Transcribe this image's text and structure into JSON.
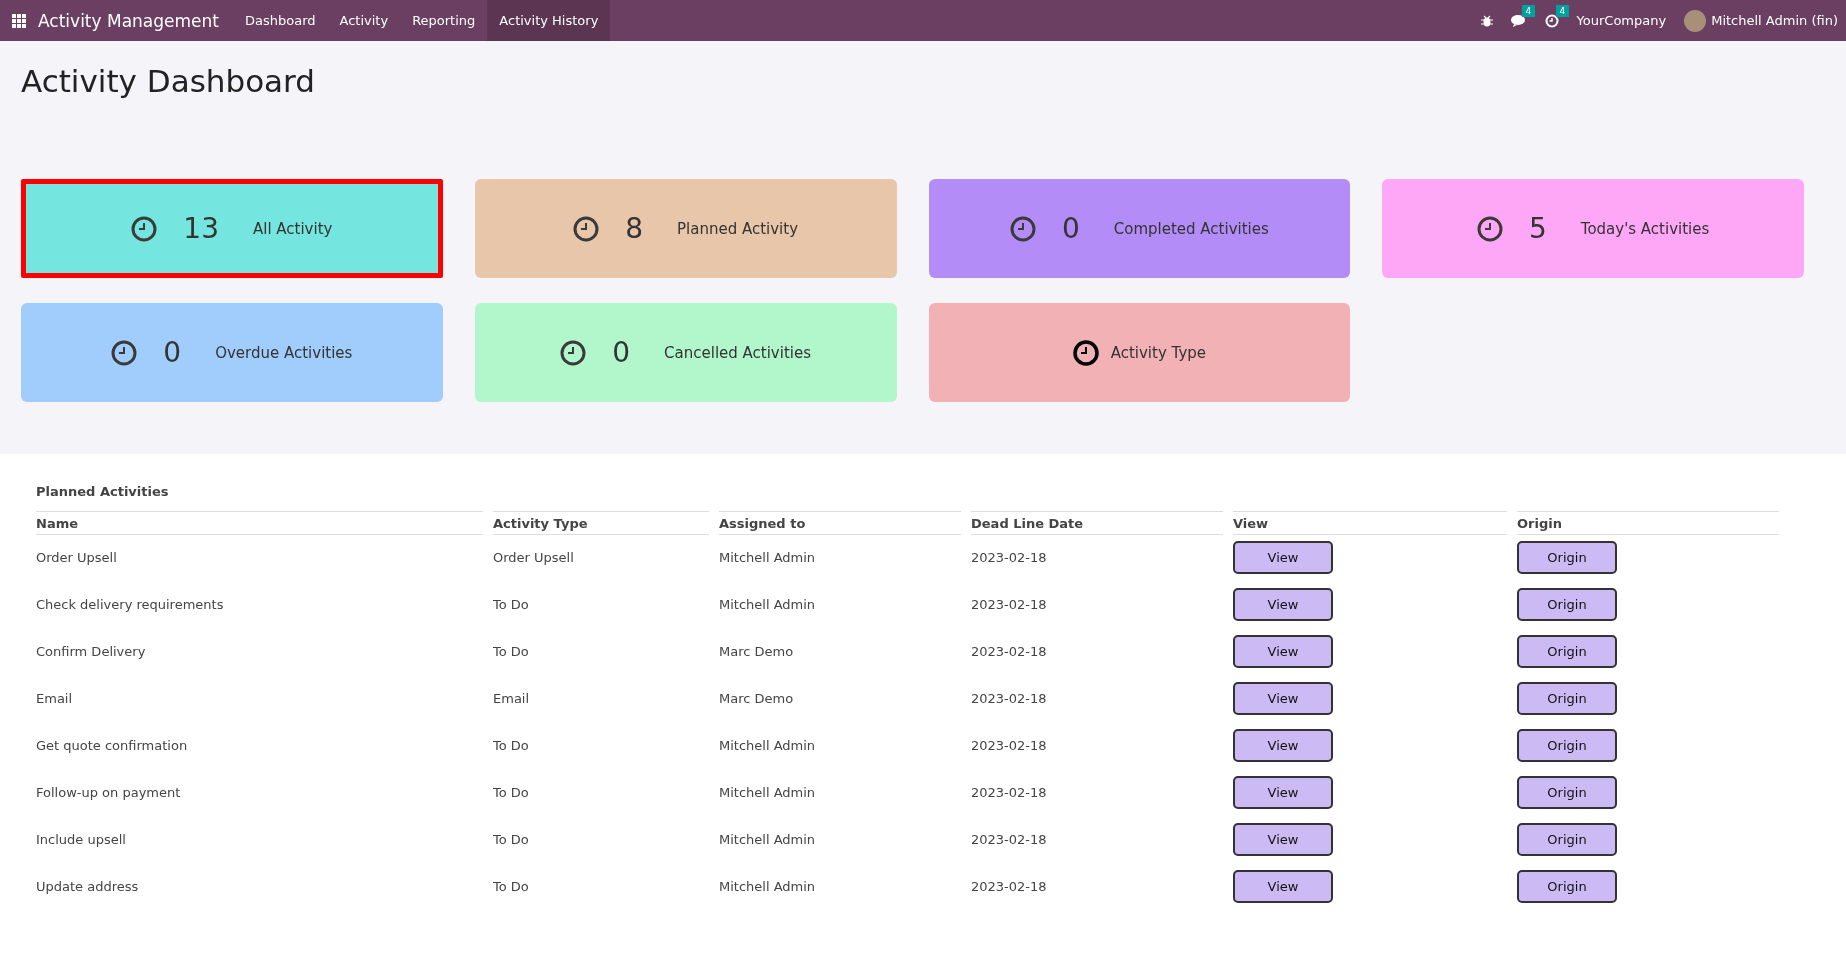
{
  "navbar": {
    "app_title": "Activity Management",
    "menu": [
      {
        "label": "Dashboard",
        "selected": false
      },
      {
        "label": "Activity",
        "selected": false
      },
      {
        "label": "Reporting",
        "selected": false
      },
      {
        "label": "Activity History",
        "selected": true
      }
    ],
    "messages_count": "4",
    "activities_count": "4",
    "company": "YourCompany",
    "user": "Mitchell Admin (fin)"
  },
  "page_title": "Activity Dashboard",
  "cards": [
    {
      "kind": "count",
      "count": "13",
      "label": "All Activity",
      "color": "#75e6df",
      "selected": true
    },
    {
      "kind": "count",
      "count": "8",
      "label": "Planned Activity",
      "color": "#e8c6a9",
      "selected": false
    },
    {
      "kind": "count",
      "count": "0",
      "label": "Completed Activities",
      "color": "#b48cf7",
      "selected": false
    },
    {
      "kind": "count",
      "count": "5",
      "label": "Today's Activities",
      "color": "#fea7f6",
      "selected": false
    },
    {
      "kind": "count",
      "count": "0",
      "label": "Overdue Activities",
      "color": "#a1cdfc",
      "selected": false
    },
    {
      "kind": "count",
      "count": "0",
      "label": "Cancelled Activities",
      "color": "#b2f6cc",
      "selected": false
    },
    {
      "kind": "type",
      "label": "Activity Type",
      "color": "#f2b1b5",
      "selected": false
    }
  ],
  "table": {
    "title": "Planned Activities",
    "columns": [
      "Name",
      "Activity Type",
      "Assigned to",
      "Dead Line Date",
      "View",
      "Origin"
    ],
    "rows": [
      {
        "name": "Order Upsell",
        "type": "Order Upsell",
        "assigned": "Mitchell Admin",
        "deadline": "2023-02-18",
        "view": "View",
        "origin": "Origin"
      },
      {
        "name": "Check delivery requirements",
        "type": "To Do",
        "assigned": "Mitchell Admin",
        "deadline": "2023-02-18",
        "view": "View",
        "origin": "Origin"
      },
      {
        "name": "Confirm Delivery",
        "type": "To Do",
        "assigned": "Marc Demo",
        "deadline": "2023-02-18",
        "view": "View",
        "origin": "Origin"
      },
      {
        "name": "Email",
        "type": "Email",
        "assigned": "Marc Demo",
        "deadline": "2023-02-18",
        "view": "View",
        "origin": "Origin"
      },
      {
        "name": "Get quote confirmation",
        "type": "To Do",
        "assigned": "Mitchell Admin",
        "deadline": "2023-02-18",
        "view": "View",
        "origin": "Origin"
      },
      {
        "name": "Follow-up on payment",
        "type": "To Do",
        "assigned": "Mitchell Admin",
        "deadline": "2023-02-18",
        "view": "View",
        "origin": "Origin"
      },
      {
        "name": "Include upsell",
        "type": "To Do",
        "assigned": "Mitchell Admin",
        "deadline": "2023-02-18",
        "view": "View",
        "origin": "Origin"
      },
      {
        "name": "Update address",
        "type": "To Do",
        "assigned": "Mitchell Admin",
        "deadline": "2023-02-18",
        "view": "View",
        "origin": "Origin"
      }
    ]
  }
}
